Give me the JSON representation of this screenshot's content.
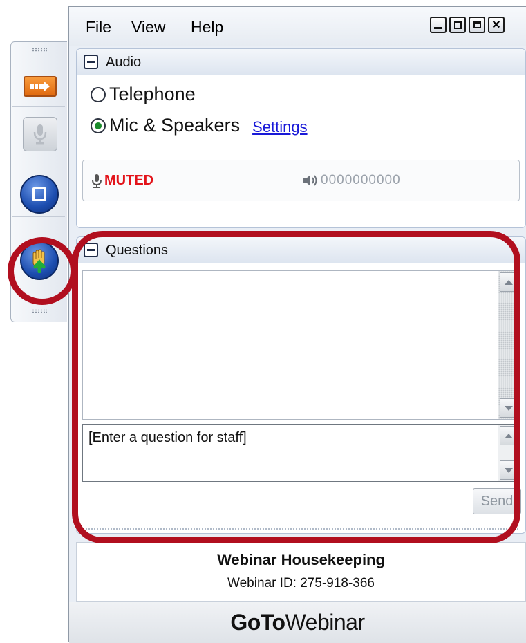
{
  "menu": {
    "file": "File",
    "view": "View",
    "help": "Help"
  },
  "audio": {
    "title": "Audio",
    "telephone": "Telephone",
    "mic_speakers": "Mic & Speakers",
    "settings": "Settings",
    "muted": "MUTED",
    "volume_level": "0000000000",
    "selected": "mic_speakers"
  },
  "questions": {
    "title": "Questions",
    "input_value": "[Enter a question for staff]",
    "send": "Send"
  },
  "info": {
    "title": "Webinar Housekeeping",
    "webinar_id": "Webinar ID: 275-918-366"
  },
  "brand": {
    "bold": "GoTo",
    "light": "Webinar"
  },
  "colors": {
    "muted": "#e3141b",
    "highlight": "#b10f1f",
    "link": "#1919d8",
    "button_orange": "#f28a2b",
    "button_blue": "#1d4eb0"
  },
  "icons": [
    "arrow-icon",
    "microphone-icon",
    "screen-icon",
    "raise-hand-icon",
    "minimize-icon",
    "restore-icon",
    "maximize-icon",
    "close-icon",
    "speaker-icon"
  ]
}
